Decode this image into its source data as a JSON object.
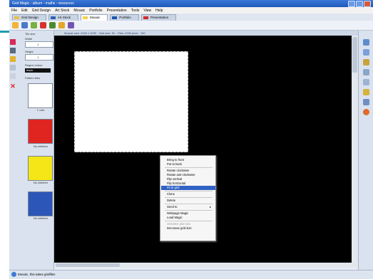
{
  "window": {
    "title": "Grid Magic - album - maths - resources",
    "controls": [
      "minimize",
      "maximize",
      "close"
    ]
  },
  "menu": [
    "File",
    "Edit",
    "Grid Design",
    "Art Stock",
    "Mosaic",
    "Portfolio",
    "Presentation",
    "Tools",
    "View",
    "Help"
  ],
  "tabs": [
    {
      "label": "Grid Design",
      "color": "#e8c14a",
      "active": false
    },
    {
      "label": "Art Stock",
      "color": "#2f5fb5",
      "active": false
    },
    {
      "label": "Mosaic",
      "color": "#f1d34a",
      "active": true
    },
    {
      "label": "Portfolio",
      "color": "#1b57b0",
      "active": false
    },
    {
      "label": "Presentation",
      "color": "#d12b2b",
      "active": false
    }
  ],
  "toolbar_icons": [
    "open-folder-icon",
    "save-icon",
    "undo-icon",
    "paint-icon",
    "tools-icon",
    "color-icon",
    "figure-icon"
  ],
  "sidebar": {
    "tile_size_label": "Tile size",
    "width_label": "Width",
    "width_value": "1",
    "height_label": "Height",
    "height_value": "1",
    "region_colour_label": "Region colour",
    "region_colour_value": "black",
    "pattern_tiles_label": "Pattern tiles",
    "tiles": [
      {
        "color": "#ffffff",
        "caption": "1 cols"
      },
      {
        "color": "#e0241f",
        "caption": "No children"
      },
      {
        "color": "#f5e617",
        "caption": "No children"
      },
      {
        "color": "#2c56b8",
        "caption": "No children"
      }
    ]
  },
  "canvas_info": "Mosaic size: 2400 x 2000 - Grid size: 51 - Tiles: 2000 pixel - 100",
  "context_menu": {
    "items": [
      {
        "label": "Bring to front",
        "state": "normal"
      },
      {
        "label": "Put to back",
        "state": "normal"
      },
      {
        "sep": true
      },
      {
        "label": "Rotate clockwise",
        "state": "normal"
      },
      {
        "label": "Rotate anti-clockwise",
        "state": "normal"
      },
      {
        "label": "Flip vertical",
        "state": "normal"
      },
      {
        "label": "Flip horizontal",
        "state": "normal"
      },
      {
        "label": "Fit to grid",
        "state": "highlighted"
      },
      {
        "sep": true
      },
      {
        "label": "Clone",
        "state": "normal"
      },
      {
        "sep": true
      },
      {
        "label": "Delete",
        "state": "normal"
      },
      {
        "sep": true
      },
      {
        "label": "Send to",
        "state": "submenu"
      },
      {
        "sep": true
      },
      {
        "label": "Webpage Magic",
        "state": "normal"
      },
      {
        "label": "Load Magic",
        "state": "normal"
      },
      {
        "sep": true
      },
      {
        "label": "Unselect grid size",
        "state": "disabled"
      },
      {
        "label": "Decrease grid size",
        "state": "normal"
      }
    ]
  },
  "status": {
    "text": "Mosaic, this takes gridfiles"
  }
}
